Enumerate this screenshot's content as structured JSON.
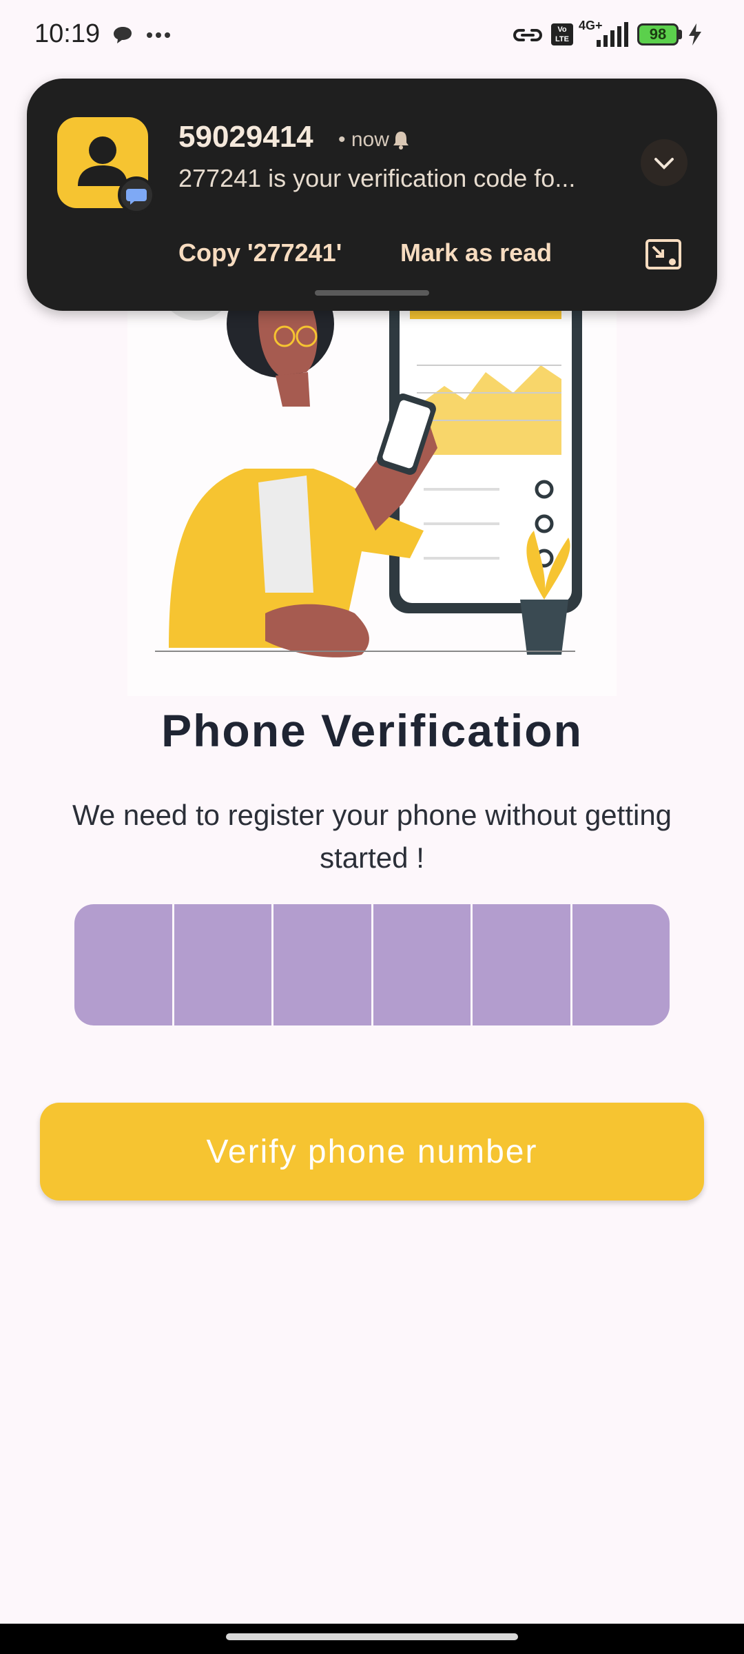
{
  "status_bar": {
    "time": "10:19",
    "battery": "98",
    "network": "4G+",
    "volte": "Vo LTE",
    "icons": [
      "chat-bubble-icon",
      "more-dots-icon",
      "link-icon",
      "volte-icon",
      "signal-icon",
      "battery-icon",
      "charging-icon"
    ]
  },
  "notification": {
    "sender": "59029414",
    "time": "• now",
    "body": "277241 is your verification code fo...",
    "action_copy": "Copy '277241'",
    "action_read": "Mark as read",
    "colors": {
      "background": "#1f1f1f",
      "avatar": "#f6c431",
      "action_text": "#f7dcc0"
    }
  },
  "page": {
    "title": "Phone Verification",
    "subtitle": "We need to register your phone without getting started  !",
    "otp_digits": [
      "",
      "",
      "",
      "",
      "",
      ""
    ],
    "verify_label": "Verify phone number",
    "colors": {
      "accent": "#f6c431",
      "otp_box": "#b39dce",
      "background": "#fdf7fb"
    }
  }
}
